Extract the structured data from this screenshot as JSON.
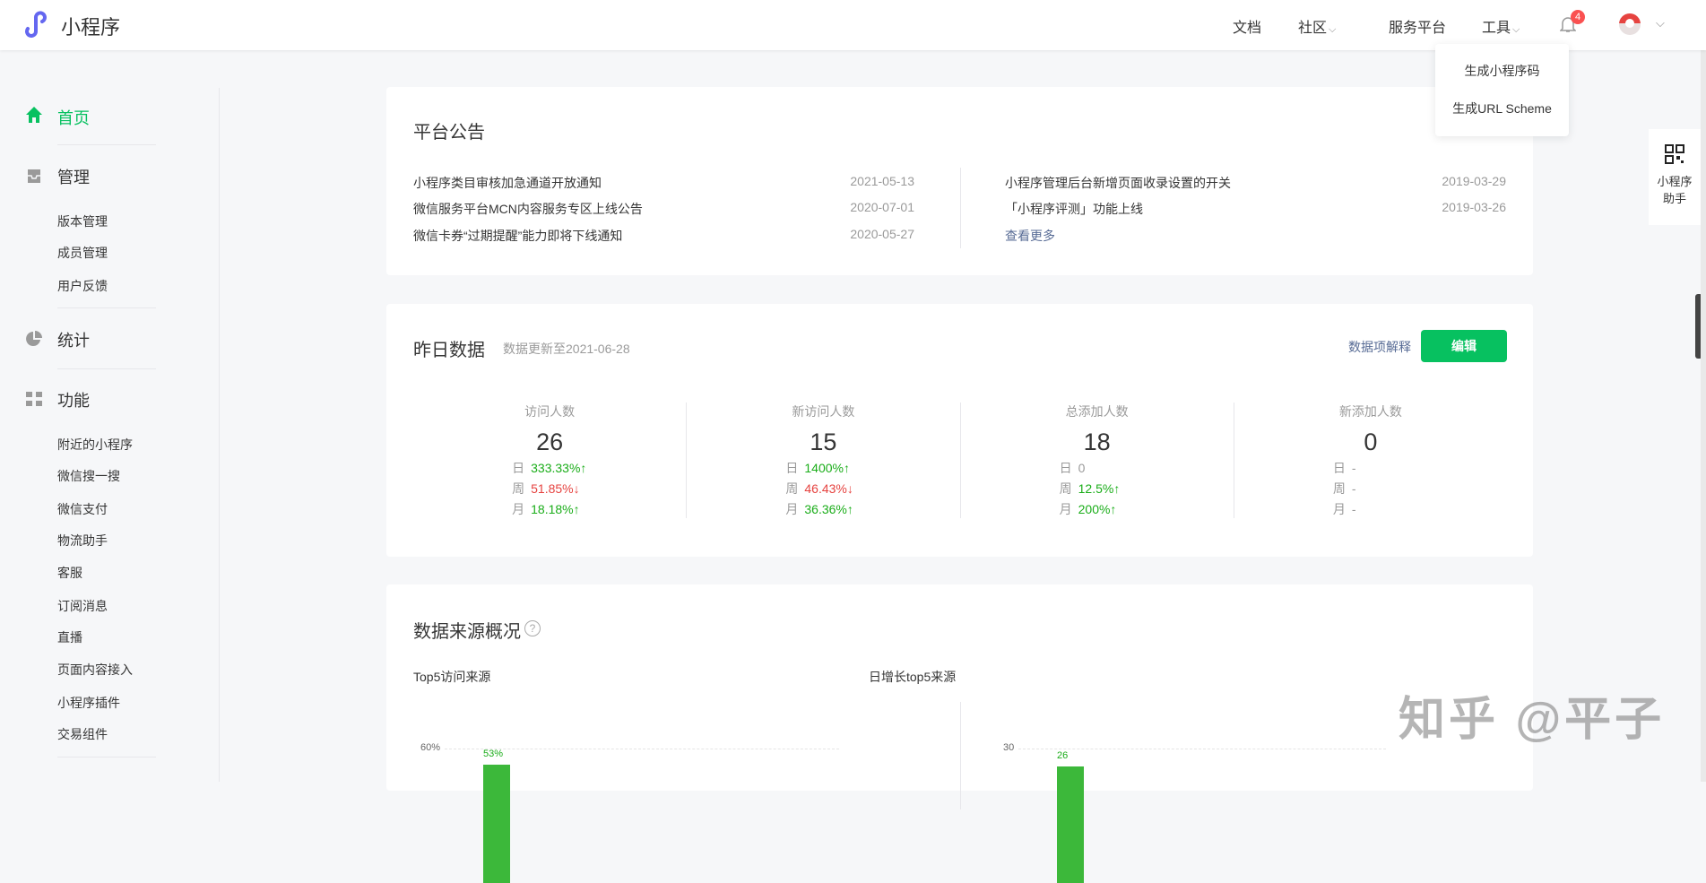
{
  "header": {
    "app_name": "小程序",
    "nav": {
      "docs": "文档",
      "community": "社区",
      "service": "服务平台",
      "tools": "工具"
    },
    "notification_count": "4"
  },
  "tools_menu": [
    "生成小程序码",
    "生成URL Scheme"
  ],
  "right_float": {
    "label1": "小程序",
    "label2": "助手"
  },
  "sidebar": {
    "home": "首页",
    "manage": "管理",
    "manage_items": [
      "版本管理",
      "成员管理",
      "用户反馈"
    ],
    "stats": "统计",
    "features": "功能",
    "feature_items": [
      "附近的小程序",
      "微信搜一搜",
      "微信支付",
      "物流助手",
      "客服",
      "订阅消息",
      "直播",
      "页面内容接入",
      "小程序插件",
      "交易组件"
    ],
    "accent": "#07c160"
  },
  "announcements": {
    "title": "平台公告",
    "left": [
      {
        "text": "小程序类目审核加急通道开放通知",
        "date": "2021-05-13"
      },
      {
        "text": "微信服务平台MCN内容服务专区上线公告",
        "date": "2020-07-01"
      },
      {
        "text": "微信卡券“过期提醒”能力即将下线通知",
        "date": "2020-05-27"
      }
    ],
    "right": [
      {
        "text": "小程序管理后台新增页面收录设置的开关",
        "date": "2019-03-29"
      },
      {
        "text": "「小程序评测」功能上线",
        "date": "2019-03-26"
      }
    ],
    "more": "查看更多"
  },
  "yesterday": {
    "title": "昨日数据",
    "updated": "数据更新至2021-06-28",
    "explain": "数据项解释",
    "edit": "编辑",
    "stats": [
      {
        "label": "访问人数",
        "value": "26",
        "rows": [
          {
            "k": "日",
            "v": "333.33%↑",
            "t": "up"
          },
          {
            "k": "周",
            "v": "51.85%↓",
            "t": "down"
          },
          {
            "k": "月",
            "v": "18.18%↑",
            "t": "up"
          }
        ]
      },
      {
        "label": "新访问人数",
        "value": "15",
        "rows": [
          {
            "k": "日",
            "v": "1400%↑",
            "t": "up"
          },
          {
            "k": "周",
            "v": "46.43%↓",
            "t": "down"
          },
          {
            "k": "月",
            "v": "36.36%↑",
            "t": "up"
          }
        ]
      },
      {
        "label": "总添加人数",
        "value": "18",
        "rows": [
          {
            "k": "日",
            "v": "0",
            "t": "neu"
          },
          {
            "k": "周",
            "v": "12.5%↑",
            "t": "up"
          },
          {
            "k": "月",
            "v": "200%↑",
            "t": "up"
          }
        ]
      },
      {
        "label": "新添加人数",
        "value": "0",
        "rows": [
          {
            "k": "日",
            "v": "-",
            "t": "neu"
          },
          {
            "k": "周",
            "v": "-",
            "t": "neu"
          },
          {
            "k": "月",
            "v": "-",
            "t": "neu"
          }
        ]
      }
    ]
  },
  "sources": {
    "title": "数据来源概况",
    "help": "?"
  },
  "chart_data": [
    {
      "type": "bar",
      "title": "Top5访问来源",
      "ytick_top": "60%",
      "ymax": 60,
      "values": [
        53
      ],
      "value_labels": [
        "53%"
      ],
      "color": "#3cb83a"
    },
    {
      "type": "bar",
      "title": "日增长top5来源",
      "ytick_top": "30",
      "ymax": 30,
      "values": [
        26
      ],
      "value_labels": [
        "26"
      ],
      "color": "#3cb83a"
    }
  ],
  "watermark": "知乎 @平子"
}
